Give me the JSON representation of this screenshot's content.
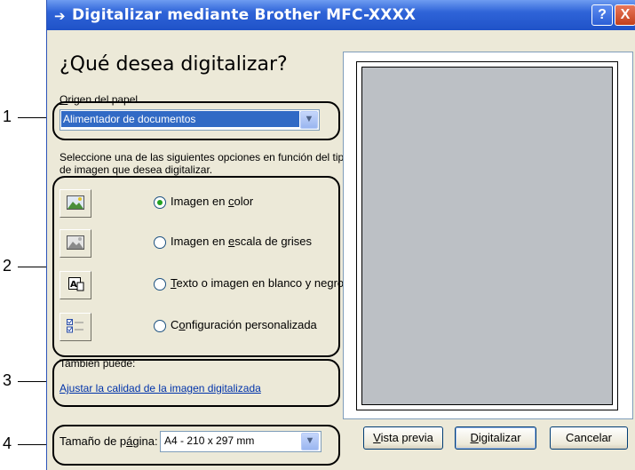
{
  "window": {
    "title": "Digitalizar mediante Brother MFC-XXXX",
    "help": "?",
    "close": "X"
  },
  "heading": "¿Qué desea digitalizar?",
  "paper_source": {
    "label_first": "O",
    "label_rest": "rigen del papel",
    "value": "Alimentador de documentos"
  },
  "instructions": "Seleccione una de las siguientes opciones en función del tipo de imagen que desea digitalizar.",
  "options": [
    {
      "pre": "Imagen en ",
      "key": "c",
      "post": "olor",
      "icon": "color-photo-icon",
      "selected": true
    },
    {
      "pre": "Imagen en ",
      "key": "e",
      "post": "scala de grises",
      "icon": "grayscale-photo-icon",
      "selected": false
    },
    {
      "pre": "",
      "key": "T",
      "post": "exto o imagen en blanco y negro",
      "icon": "bw-text-icon",
      "selected": false
    },
    {
      "pre": "C",
      "key": "o",
      "post": "nfiguración personalizada",
      "icon": "custom-settings-icon",
      "selected": false
    }
  ],
  "also": {
    "label": "También puede:",
    "link": "Ajustar la calidad de la imagen digitalizada"
  },
  "page_size": {
    "label_pre": "Tamaño de p",
    "label_key": "á",
    "label_post": "gina:",
    "value": "A4 - 210 x 297 mm"
  },
  "buttons": {
    "preview_key": "V",
    "preview_rest": "ista previa",
    "scan_key": "D",
    "scan_rest": "igitalizar",
    "cancel": "Cancelar"
  },
  "callouts": [
    "1",
    "2",
    "3",
    "4"
  ],
  "colors": {
    "titlebar": "#2f64d8",
    "dialog_bg": "#ece9d8",
    "selection": "#316ac5",
    "link": "#0033aa",
    "preview_gray": "#bcc0c5"
  }
}
